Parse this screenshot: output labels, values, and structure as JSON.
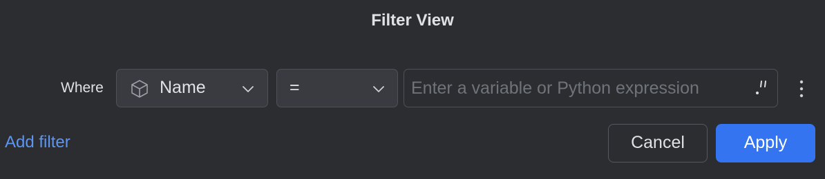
{
  "dialog": {
    "title": "Filter View"
  },
  "filter_row": {
    "where_label": "Where",
    "field": {
      "icon": "cube-icon",
      "value": "Name"
    },
    "operator": {
      "value": "="
    },
    "expression": {
      "value": "",
      "placeholder": "Enter a variable or Python expression",
      "expand_icon": "expand-icon"
    },
    "more_icon": "vertical-ellipsis-icon"
  },
  "footer": {
    "add_filter_label": "Add filter",
    "cancel_label": "Cancel",
    "apply_label": "Apply"
  },
  "colors": {
    "background": "#2b2d30",
    "accent": "#3574f0",
    "link": "#5d95f1"
  }
}
